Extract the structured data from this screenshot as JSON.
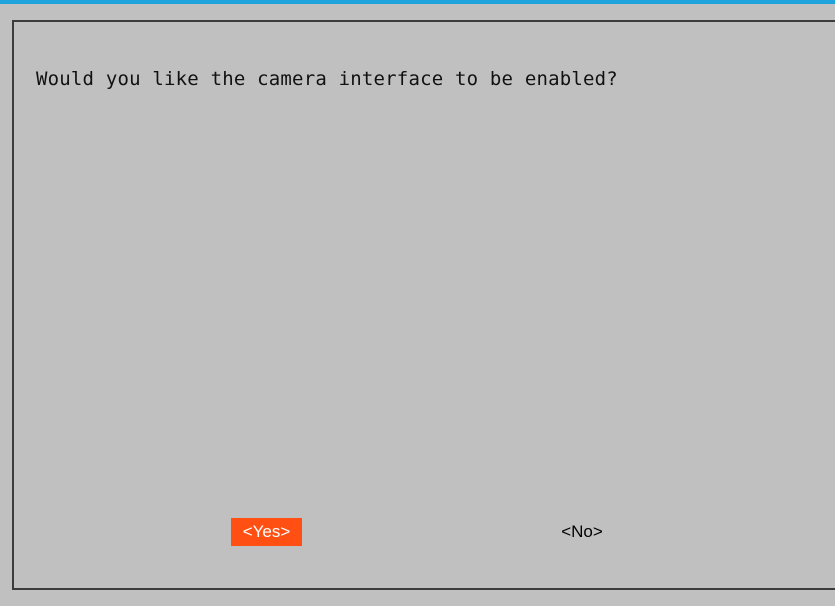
{
  "dialog": {
    "question": "Would you like the camera interface to be enabled?",
    "yes_label": "<Yes>",
    "no_label": "<No>",
    "selected": "yes"
  },
  "colors": {
    "background": "#c0c0c0",
    "accent_top_line": "#1ea3dc",
    "selected_button": "#ff4f12",
    "border": "#3c3c3c"
  }
}
